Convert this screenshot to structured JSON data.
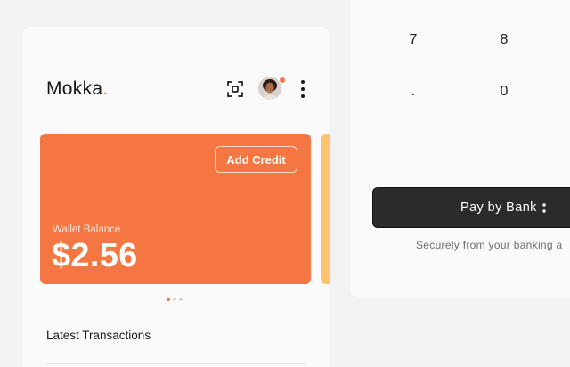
{
  "app": {
    "brand_name": "Mokka",
    "brand_dot": "."
  },
  "header": {
    "icons": [
      "scan-icon",
      "avatar",
      "kebab-menu-icon"
    ],
    "notification_color": "#f47642"
  },
  "wallet_card": {
    "add_credit_label": "Add Credit",
    "balance_label": "Wallet Balance",
    "balance_amount": "$2.56",
    "card_color": "#f47642",
    "next_card_color": "#fcc46e"
  },
  "carousel": {
    "page_count": 3,
    "active_index": 0
  },
  "transactions": {
    "title": "Latest Transactions"
  },
  "keypad": {
    "keys": [
      "7",
      "8",
      ".",
      "0"
    ]
  },
  "payment": {
    "pay_label": "Pay by Bank",
    "secure_text": "Securely from your banking a"
  }
}
